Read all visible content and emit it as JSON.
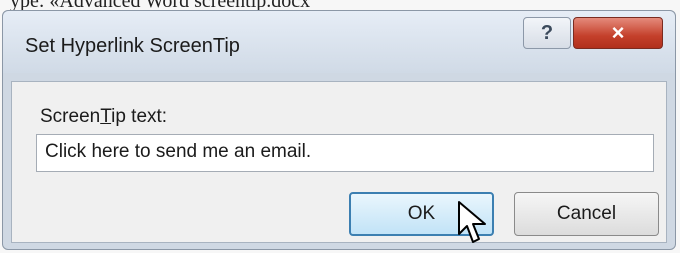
{
  "background": {
    "doc_snippet": "ype: «Advanced Word screentip.docx"
  },
  "dialog": {
    "title": "Set Hyperlink ScreenTip",
    "help_label": "?",
    "close_label": "×",
    "label_prefix": "Screen",
    "label_underlined": "T",
    "label_suffix": "ip text:",
    "screentip_value": "Click here to send me an email.",
    "ok_label": "OK",
    "cancel_label": "Cancel"
  },
  "colors": {
    "close_button_red": "#c4402b",
    "ok_button_border": "#3c7fb1",
    "dialog_frame": "#cfd8e3"
  },
  "icons": {
    "cursor": "arrow-pointer-icon"
  }
}
